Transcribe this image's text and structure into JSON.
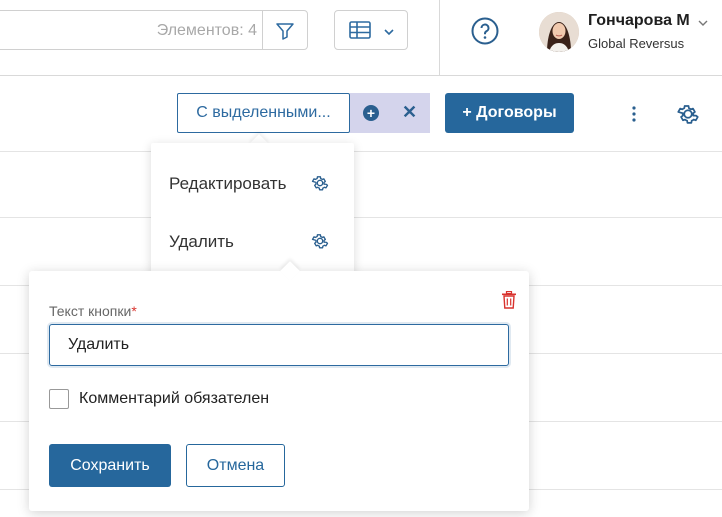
{
  "header": {
    "search": {
      "count_text": "Элементов: 4",
      "icon": "filter-icon"
    },
    "view_switch": {
      "icon": "table-icon"
    },
    "help_icon": "help-circle-icon",
    "user": {
      "name": "Гончарова М",
      "organization": "Global Reversus"
    }
  },
  "toolbar": {
    "with_selected_label": "С выделенными...",
    "add_label": "+ Договоры",
    "add_icon": "plus-circle-icon",
    "clear_icon": "close-icon",
    "more_icon": "kebab-icon",
    "settings_icon": "gear-icon"
  },
  "menu": {
    "items": [
      {
        "label": "Редактировать",
        "icon": "gear-icon"
      },
      {
        "label": "Удалить",
        "icon": "gear-icon"
      }
    ]
  },
  "popup": {
    "field_label": "Текст кнопки",
    "required_mark": "*",
    "field_value": "Удалить",
    "checkbox_label": "Комментарий обязателен",
    "checkbox_checked": false,
    "save_label": "Сохранить",
    "cancel_label": "Отмена",
    "delete_icon": "trash-icon"
  },
  "colors": {
    "primary": "#26679c",
    "tray": "#d4d4ec",
    "danger": "#d9332e"
  }
}
